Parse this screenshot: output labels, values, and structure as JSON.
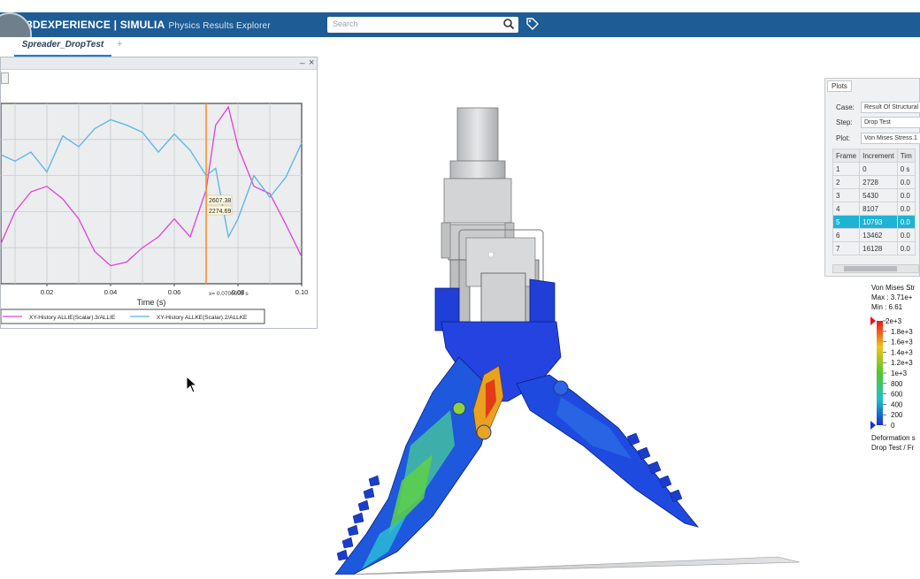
{
  "app": {
    "brand_bold": "3DEXPERIENCE | SIMULIA",
    "brand_sub": "Physics Results Explorer",
    "search_placeholder": "Search",
    "tab": "Spreader_DropTest A.1",
    "tab_add": "+"
  },
  "plot_window": {
    "minimize": "_",
    "close": "×"
  },
  "chart_data": {
    "type": "line",
    "xlabel": "Time (s)",
    "xlim": [
      0.0,
      0.1
    ],
    "x_ticks": [
      "0.02",
      "0.04",
      "0.06",
      "0.08",
      "0.10"
    ],
    "ylim": [
      2000,
      3000
    ],
    "cursor_x": 0.07,
    "cursor_label": "x= 0.0700005 s",
    "tooltip": [
      "2607.38",
      "2274.69"
    ],
    "series": [
      {
        "name": "XY-History ALLIE(Scalar).3/ALLIE",
        "color": "#e040d8",
        "x": [
          0.0,
          0.005,
          0.01,
          0.015,
          0.02,
          0.025,
          0.03,
          0.035,
          0.04,
          0.045,
          0.05,
          0.055,
          0.06,
          0.065,
          0.07,
          0.073,
          0.077,
          0.08,
          0.085,
          0.09,
          0.095,
          0.1
        ],
        "values": [
          2080,
          2200,
          2400,
          2510,
          2540,
          2470,
          2360,
          2180,
          2100,
          2120,
          2200,
          2260,
          2360,
          2260,
          2520,
          2880,
          2980,
          2760,
          2540,
          2500,
          2330,
          2150
        ]
      },
      {
        "name": "XY-History ALLKE(Scalar).2/ALLKE",
        "color": "#58b4e2",
        "x": [
          0.0,
          0.005,
          0.01,
          0.015,
          0.02,
          0.025,
          0.03,
          0.035,
          0.04,
          0.045,
          0.05,
          0.055,
          0.06,
          0.065,
          0.07,
          0.073,
          0.077,
          0.08,
          0.085,
          0.09,
          0.095,
          0.1
        ],
        "values": [
          2900,
          2720,
          2680,
          2730,
          2620,
          2820,
          2760,
          2860,
          2910,
          2880,
          2840,
          2730,
          2830,
          2740,
          2600,
          2640,
          2260,
          2360,
          2600,
          2480,
          2590,
          2780
        ]
      }
    ]
  },
  "plots_panel": {
    "tab": "Plots",
    "case_label": "Case:",
    "case_value": "Result Of Structural",
    "step_label": "Step:",
    "step_value": "Drop Test",
    "plot_label": "Plot:",
    "plot_value": "Von Mises Stress.1",
    "columns": [
      "Frame",
      "Increment",
      "Tim"
    ],
    "rows": [
      [
        "1",
        "0",
        "0 s"
      ],
      [
        "2",
        "2728",
        "0.0"
      ],
      [
        "3",
        "5430",
        "0.0"
      ],
      [
        "4",
        "8107",
        "0.0"
      ],
      [
        "5",
        "10793",
        "0.0"
      ],
      [
        "6",
        "13462",
        "0.0"
      ],
      [
        "7",
        "16128",
        "0.0"
      ]
    ],
    "selected_row": 4
  },
  "legend": {
    "title": "Von Mises Str",
    "max": "Max : 3.71e+",
    "min": "Min : 6.61",
    "levels": [
      "2e+3",
      "1.8e+3",
      "1.6e+3",
      "1.4e+3",
      "1.2e+3",
      "1e+3",
      "800",
      "600",
      "400",
      "200",
      "0"
    ],
    "footer1": "Deformation s",
    "footer2": "Drop Test / Fr"
  },
  "colors": {
    "appbar": "#1d5c95",
    "accent": "#1d7bd1",
    "selected_row": "#1fb3d3",
    "cursor_line": "#ff8c1a"
  }
}
